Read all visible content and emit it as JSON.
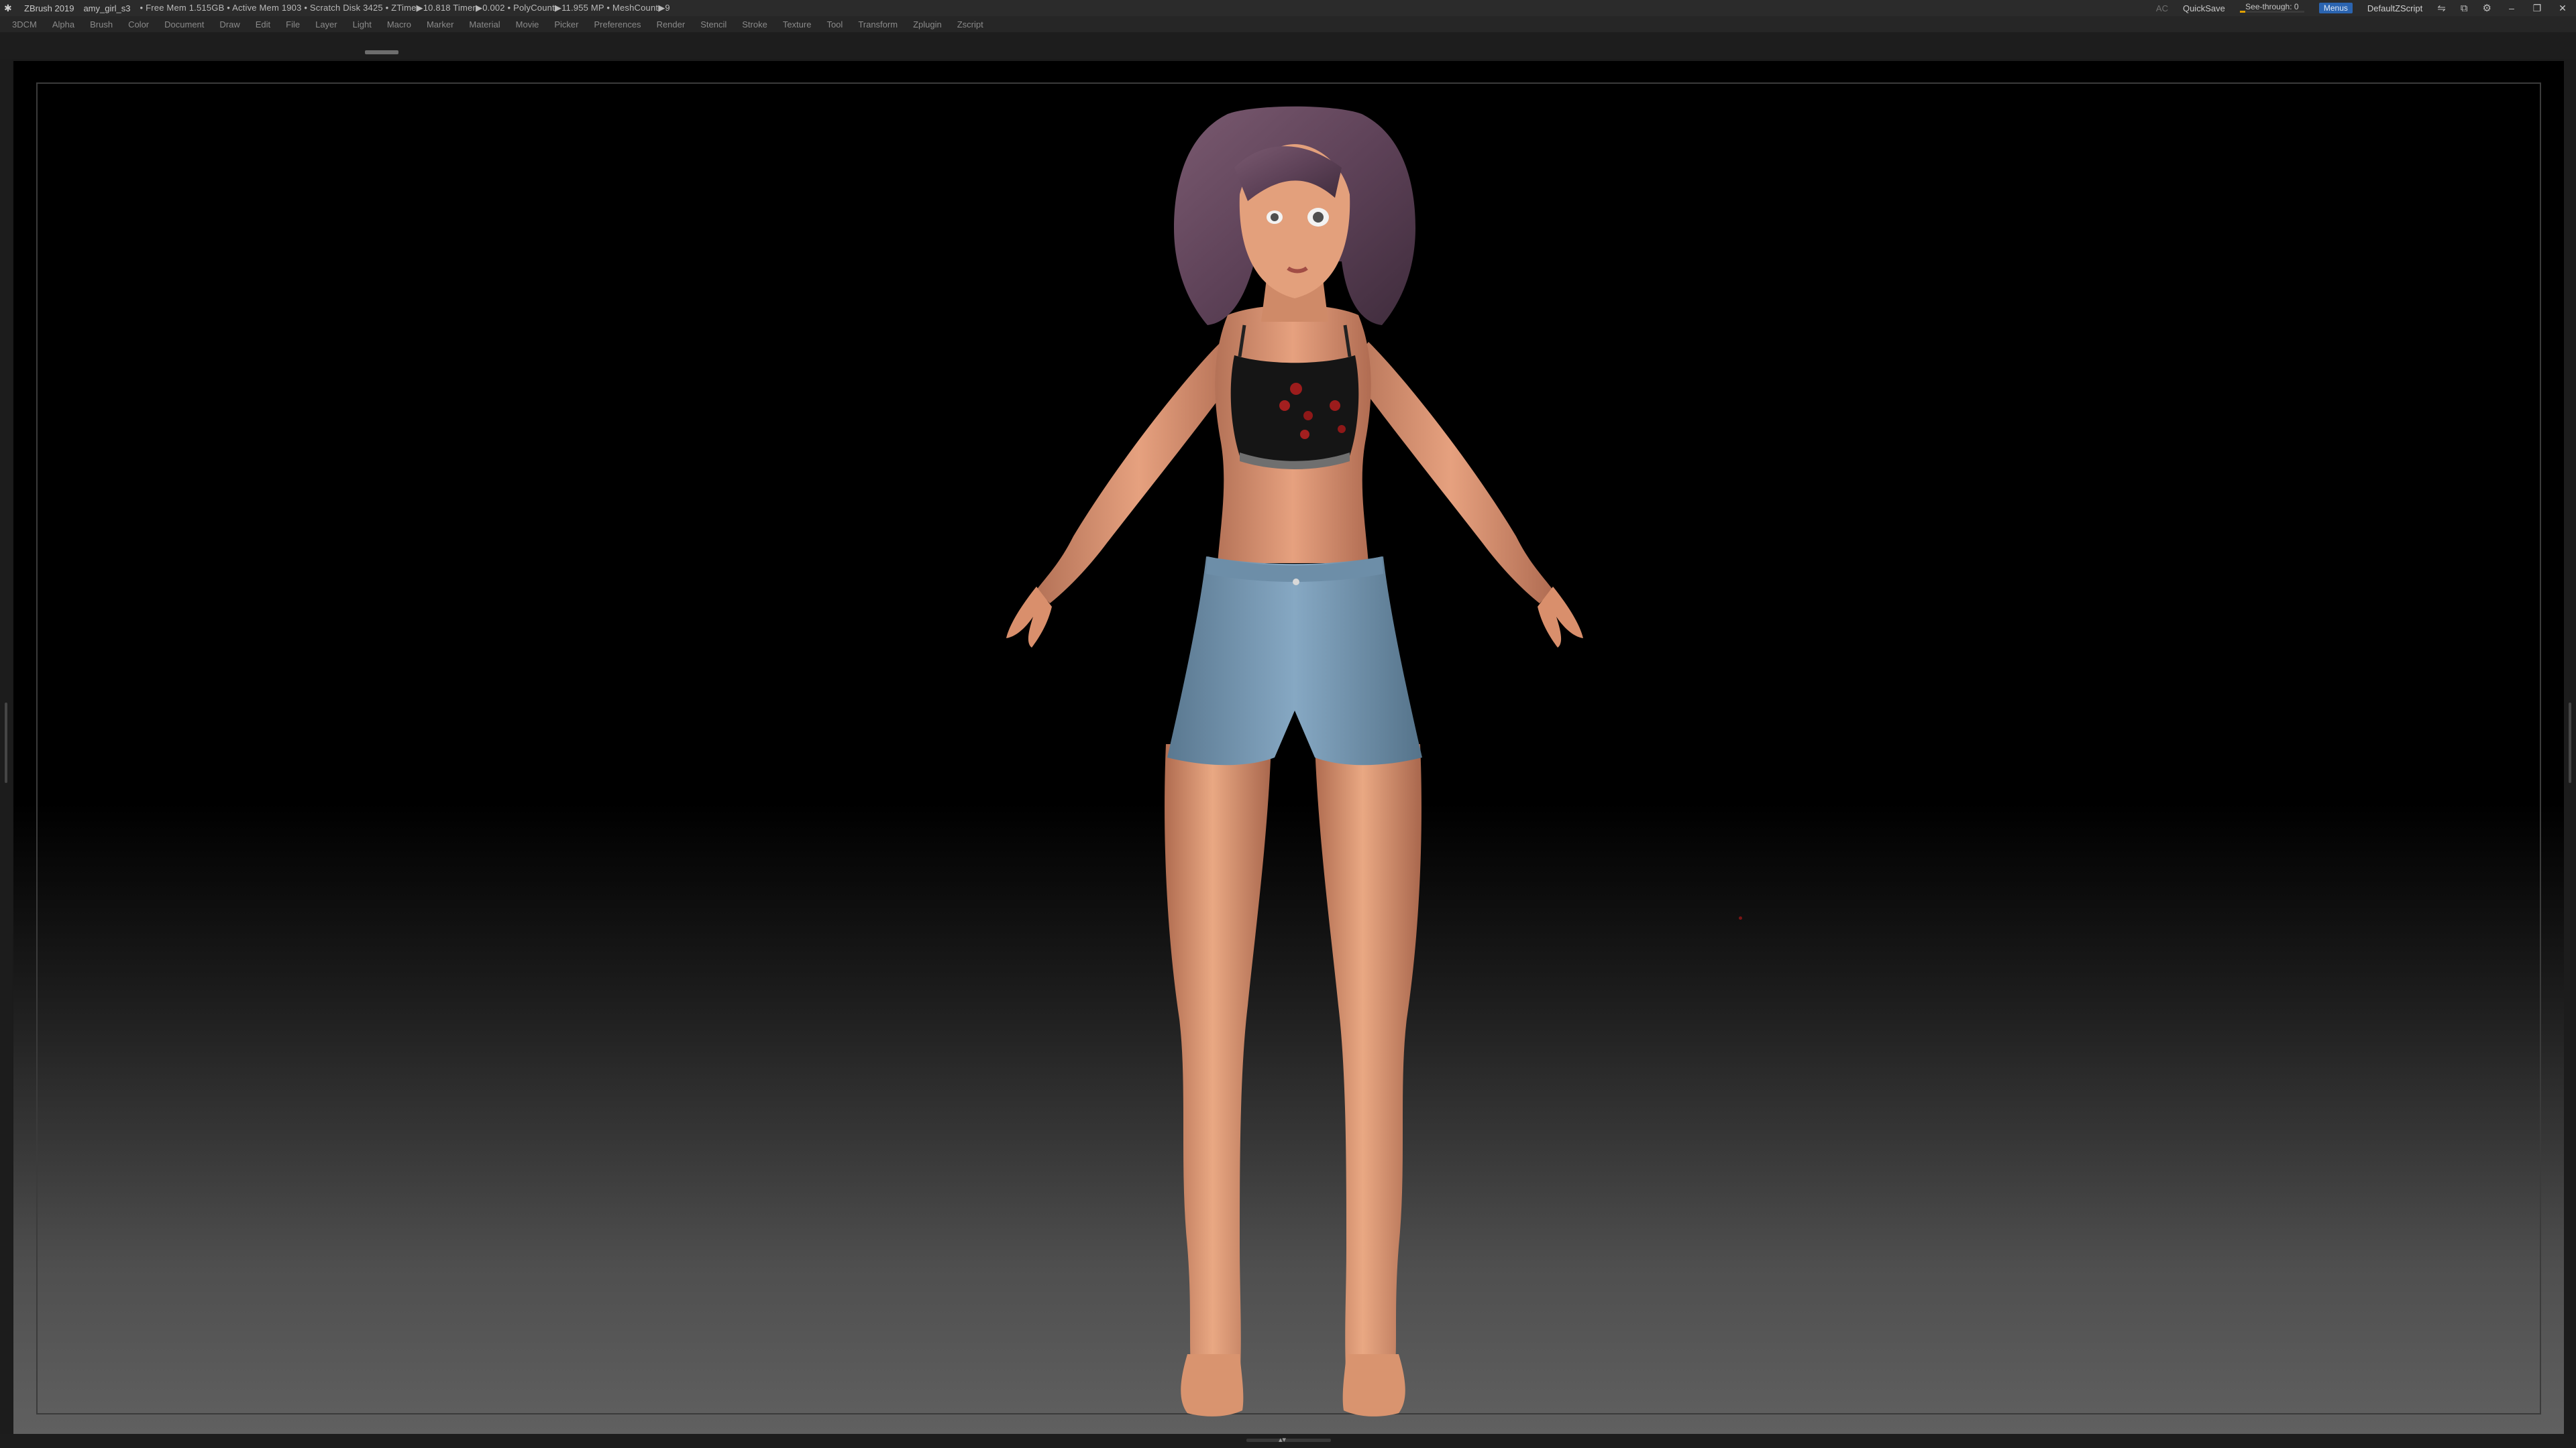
{
  "titlebar": {
    "app_title": "ZBrush 2019",
    "project_name": "amy_girl_s3",
    "stats": "• Free Mem 1.515GB • Active Mem 1903 • Scratch Disk 3425 • ZTime▶10.818 Timer▶0.002 • PolyCount▶11.955 MP • MeshCount▶9",
    "ac_label": "AC",
    "quicksave_label": "QuickSave",
    "seethrough_label": "See-through",
    "seethrough_value": "0",
    "seethrough_fraction": 0,
    "menus_label": "Menus",
    "script_label": "DefaultZScript"
  },
  "menubar": {
    "items": [
      "3DCM",
      "Alpha",
      "Brush",
      "Color",
      "Document",
      "Draw",
      "Edit",
      "File",
      "Layer",
      "Light",
      "Macro",
      "Marker",
      "Material",
      "Movie",
      "Picker",
      "Preferences",
      "Render",
      "Stencil",
      "Stroke",
      "Texture",
      "Tool",
      "Transform",
      "Zplugin",
      "Zscript"
    ]
  },
  "icons": {
    "logo": "zbrush-logo-icon",
    "window_controls": [
      "minimize-icon",
      "restore-icon",
      "close-icon"
    ]
  },
  "colors": {
    "menus_accent": "#2b64b0",
    "seethrough_accent": "#e0a000",
    "background": "#000000"
  }
}
